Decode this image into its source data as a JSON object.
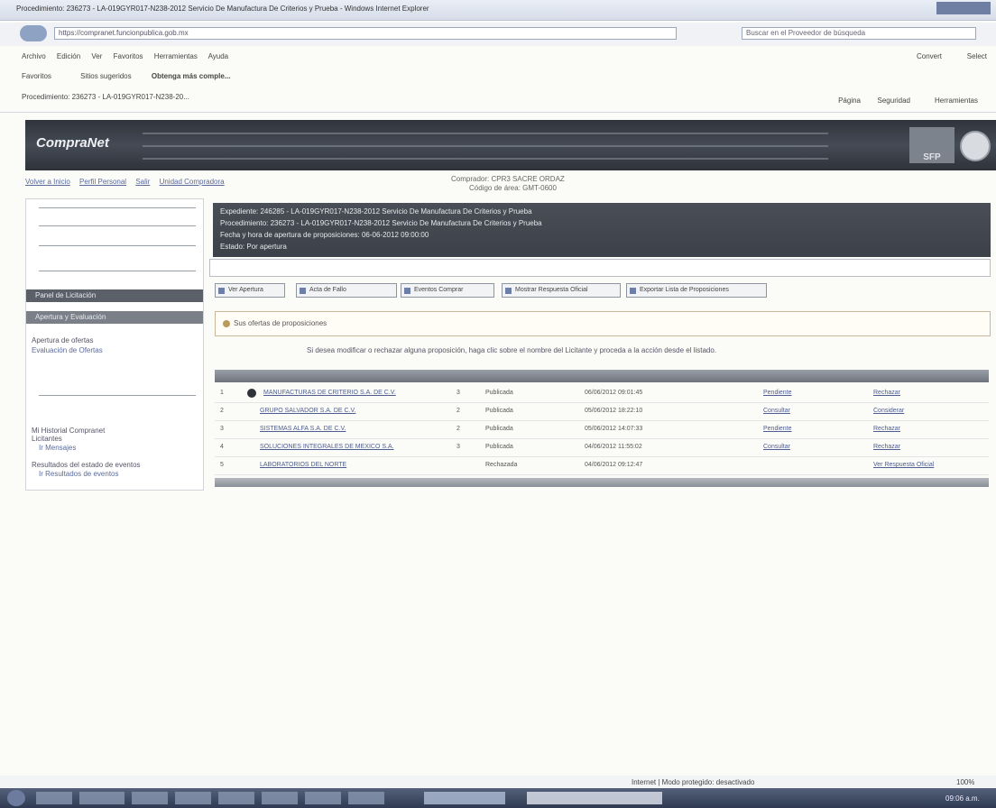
{
  "window": {
    "title": "Procedimiento: 236273 - LA-019GYR017-N238-2012 Servicio De Manufactura De Criterios y Prueba - Windows Internet Explorer"
  },
  "browser": {
    "url": "https://compranet.funcionpublica.gob.mx",
    "search_placeholder": "Buscar en el Proveedor de búsqueda",
    "menu": [
      "Archivo",
      "Edición",
      "Ver",
      "Favoritos",
      "Herramientas",
      "Ayuda"
    ],
    "favorites_label": "Favoritos",
    "fav_suggested": "Sitios sugeridos",
    "fav_more": "Obtenga más comple...",
    "convert_label": "Convert",
    "select_label": "Select",
    "tab_title": "Procedimiento: 236273 - LA-019GYR017-N238-20...",
    "cmd": [
      "Página",
      "Seguridad",
      "Herramientas"
    ]
  },
  "site": {
    "logo": "CompraNet",
    "brand_right": "SFP",
    "top_links": [
      "Volver a Inicio",
      "Perfil Personal",
      "Salir",
      "Unidad Compradora"
    ],
    "user_line1": "Comprador: CPR3 SACRE ORDAZ",
    "user_line2": "Código de área: GMT-0600"
  },
  "sidebar": {
    "section_active": "Apertura y Evaluación",
    "section_dark": "Panel de Licitación",
    "item1": "Apertura de ofertas",
    "item2": "Evaluación de Ofertas",
    "footer1": "Mi Historial Compranet",
    "footer1_sub": "Licitantes",
    "footer1_link": "Ir Mensajes",
    "footer2": "Resultados del estado de eventos",
    "footer2_link": "Ir Resultados de eventos"
  },
  "info": {
    "line1": "Expediente: 246285 - LA-019GYR017-N238-2012 Servicio De Manufactura De Criterios y Prueba",
    "line2": "Procedimiento: 236273 - LA-019GYR017-N238-2012 Servicio De Manufactura De Criterios y Prueba",
    "line3": "Fecha y hora de apertura de proposiciones: 06-06-2012 09:00:00",
    "line4": "Estado: Por apertura"
  },
  "buttons": {
    "b1": "Ver Apertura",
    "b2": "Acta de Fallo",
    "b3": "Eventos Comprar",
    "b4": "Mostrar Respuesta Oficial",
    "b5": "Exportar Lista de Proposiciones"
  },
  "section": {
    "title": "Sus ofertas de proposiciones"
  },
  "notice": "Si desea modificar o rechazar alguna proposición, haga clic sobre el nombre del Licitante y proceda a la acción desde el listado.",
  "rows": [
    {
      "num": "1",
      "name": "MANUFACTURAS DE CRITERIO S.A. DE C.V.",
      "qty": "3",
      "status": "Publicada",
      "date": "06/06/2012 09:01:45",
      "link": "Pendiente",
      "action": "Rechazar"
    },
    {
      "num": "2",
      "name": "GRUPO SALVADOR S.A. DE C.V.",
      "qty": "2",
      "status": "Publicada",
      "date": "05/06/2012 18:22:10",
      "link": "Consultar",
      "action": "Considerar"
    },
    {
      "num": "3",
      "name": "SISTEMAS ALFA S.A. DE C.V.",
      "qty": "2",
      "status": "Publicada",
      "date": "05/06/2012 14:07:33",
      "link": "Pendiente",
      "action": "Rechazar"
    },
    {
      "num": "4",
      "name": "SOLUCIONES INTEGRALES DE MEXICO S.A.",
      "qty": "3",
      "status": "Publicada",
      "date": "04/06/2012 11:55:02",
      "link": "Consultar",
      "action": "Rechazar"
    },
    {
      "num": "5",
      "name": "LABORATORIOS DEL NORTE",
      "qty": "",
      "status": "Rechazada",
      "date": "04/06/2012 09:12:47",
      "link": "",
      "action": "Ver Respuesta Oficial"
    }
  ],
  "statusbar": {
    "zone": "Internet | Modo protegido: desactivado",
    "zoom": "100%"
  },
  "taskbar": {
    "clock": "09:06 a.m."
  }
}
